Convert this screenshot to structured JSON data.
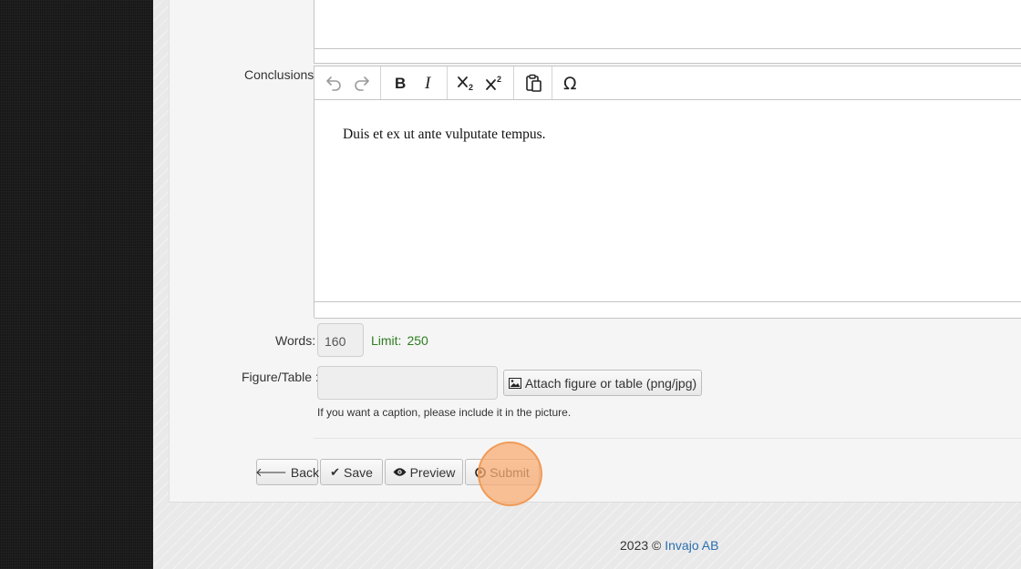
{
  "form": {
    "conclusions_label": "Conclusions:",
    "conclusions_text": "Duis et ex ut ante vulputate tempus.",
    "words_label": "Words:",
    "words_value": "160",
    "limit_label": "Limit:",
    "limit_value": "250",
    "figure_label": "Figure/Table :",
    "figure_value": "",
    "attach_label": "Attach figure or table (png/jpg)",
    "caption_hint": "If you want a caption, please include it in the picture."
  },
  "toolbar": {
    "buttons": [
      "undo-icon",
      "redo-icon",
      "bold-icon",
      "italic-icon",
      "subscript-icon",
      "superscript-icon",
      "paste-icon",
      "omega-icon"
    ]
  },
  "actions": {
    "back": "Back",
    "save": "Save",
    "preview": "Preview",
    "submit": "Submit"
  },
  "footer": {
    "copyright": "2023 ©",
    "company": "Invajo AB"
  },
  "colors": {
    "limit_green": "#2e7d1f",
    "link_blue": "#2a6fb0",
    "highlight_orange": "#f8aa6e"
  }
}
